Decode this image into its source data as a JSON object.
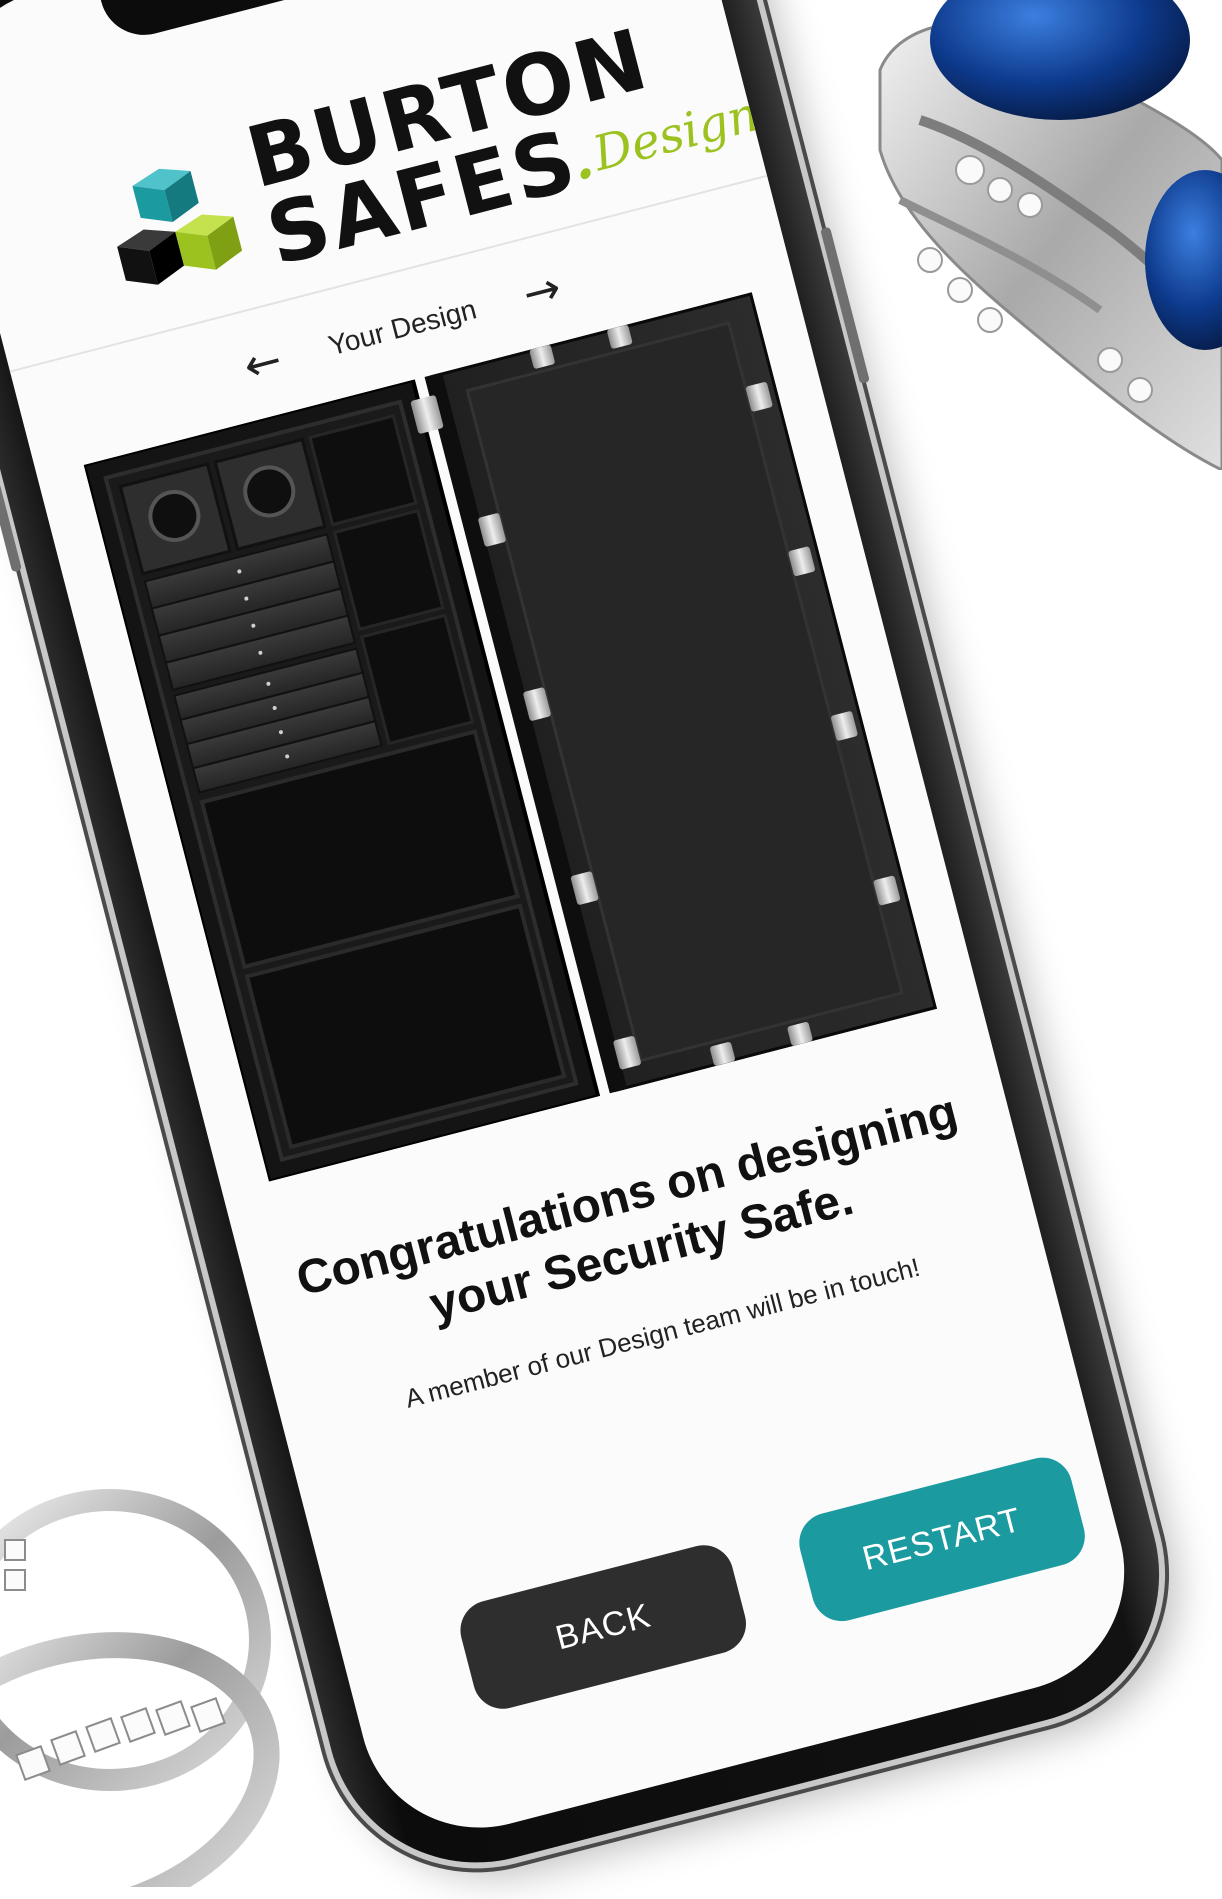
{
  "brand": {
    "line1": "BURTON",
    "line2": "SAFES",
    "dot": ".",
    "script": "Design",
    "logo_colors": {
      "teal": "#1b9aa0",
      "lime": "#9bc21f",
      "black": "#111111"
    }
  },
  "nav": {
    "title": "Your Design",
    "prev_icon": "arrow-left-icon",
    "next_icon": "arrow-right-icon",
    "prev_glyph": "←",
    "next_glyph": "→"
  },
  "safe_image": {
    "subject": "open security safe with watch winders and drawers",
    "interior_color": "#1a1a1a",
    "hinge_color": "#bdbdbd"
  },
  "message": {
    "headline": "Congratulations on designing your Security Safe.",
    "subtext": "A member of our Design team will be in touch!"
  },
  "buttons": {
    "back": {
      "label": "BACK",
      "color": "#2e2e2e"
    },
    "restart": {
      "label": "RESTART",
      "color": "#1b9aa0"
    }
  },
  "decor": {
    "top_right": "sapphire-ring-icon",
    "bottom_left": "diamond-band-rings-icon"
  }
}
